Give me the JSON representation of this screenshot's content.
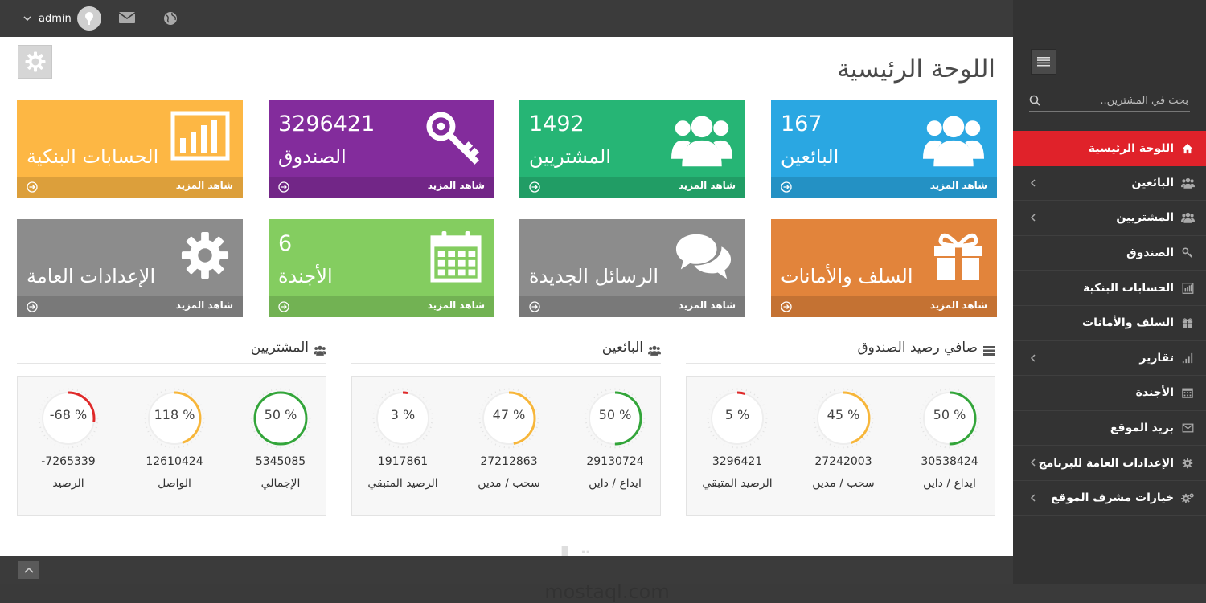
{
  "topbar": {
    "username": "admin"
  },
  "sidebar": {
    "search_placeholder": "بحث في المشترين..",
    "items": [
      {
        "label": "اللوحة الرئيسية",
        "icon": "home-icon",
        "active": true
      },
      {
        "label": "البائعين",
        "icon": "users-icon",
        "has_children": true
      },
      {
        "label": "المشتريين",
        "icon": "users-icon",
        "has_children": true
      },
      {
        "label": "الصندوق",
        "icon": "key-icon"
      },
      {
        "label": "الحسابات البنكية",
        "icon": "bar-chart-icon"
      },
      {
        "label": "السلف والأمانات",
        "icon": "gift-icon"
      },
      {
        "label": "تقارير",
        "icon": "signal-icon",
        "has_children": true
      },
      {
        "label": "الأجندة",
        "icon": "calendar-icon"
      },
      {
        "label": "بريد الموقع",
        "icon": "envelope-icon"
      },
      {
        "label": "الإعدادات العامة للبرنامج",
        "icon": "gear-icon",
        "has_children": true
      },
      {
        "label": "خيارات مشرف الموقع",
        "icon": "gears-icon",
        "has_children": true
      }
    ]
  },
  "main": {
    "title": "اللوحة الرئيسية",
    "see_more": "شاهد المزيد",
    "tiles": [
      {
        "label": "البائعين",
        "count": "167",
        "color": "#2aa7e2",
        "icon": "users-icon"
      },
      {
        "label": "المشتريين",
        "count": "1492",
        "color": "#26b575",
        "icon": "users-icon"
      },
      {
        "label": "الصندوق",
        "count": "3296421",
        "color": "#832c9c",
        "icon": "key-icon"
      },
      {
        "label": "الحسابات البنكية",
        "count": "",
        "color": "#fdb744",
        "icon": "bar-chart-icon"
      },
      {
        "label": "السلف والأمانات",
        "count": "",
        "color": "#e2843b",
        "icon": "gift-icon"
      },
      {
        "label": "الرسائل الجديدة",
        "count": "",
        "color": "#8c8c8c",
        "icon": "comments-icon"
      },
      {
        "label": "الأجندة",
        "count": "6",
        "color": "#84cd60",
        "icon": "calendar-icon"
      },
      {
        "label": "الإعدادات العامة",
        "count": "",
        "color": "#8c8c8c",
        "icon": "gear-icon"
      }
    ],
    "sections": [
      {
        "title": "صافي رصيد الصندوق",
        "icon": "server-icon",
        "gauges": [
          {
            "pct": "50 %",
            "value": "30538424",
            "label": "ايداع / داين",
            "fraction": 0.5,
            "color": "#33a53a"
          },
          {
            "pct": "45 %",
            "value": "27242003",
            "label": "سحب / مدين",
            "fraction": 0.45,
            "color": "#f7b63a"
          },
          {
            "pct": "5 %",
            "value": "3296421",
            "label": "الرصيد المتبقي",
            "fraction": 0.05,
            "color": "#df2a2a"
          }
        ]
      },
      {
        "title": "البائعين",
        "icon": "users-icon",
        "gauges": [
          {
            "pct": "50 %",
            "value": "29130724",
            "label": "ايداع / داين",
            "fraction": 0.5,
            "color": "#33a53a"
          },
          {
            "pct": "47 %",
            "value": "27212863",
            "label": "سحب / مدين",
            "fraction": 0.47,
            "color": "#f7b63a"
          },
          {
            "pct": "3 %",
            "value": "1917861",
            "label": "الرصيد المتبقي",
            "fraction": 0.03,
            "color": "#df2a2a"
          }
        ]
      },
      {
        "title": "المشتريين",
        "icon": "users-icon",
        "gauges": [
          {
            "pct": "50 %",
            "value": "5345085",
            "label": "الإجمالي",
            "fraction": 1.0,
            "color": "#33a53a"
          },
          {
            "pct": "118 %",
            "value": "12610424",
            "label": "الواصل",
            "fraction": 0.45,
            "color": "#f7b63a"
          },
          {
            "pct": "-68 %",
            "value": "-7265339",
            "label": "الرصيد",
            "fraction": 0.27,
            "color": "#df2a2a"
          }
        ]
      }
    ]
  },
  "watermark": {
    "line1": "مستقل",
    "line2": "mostaql.com"
  }
}
